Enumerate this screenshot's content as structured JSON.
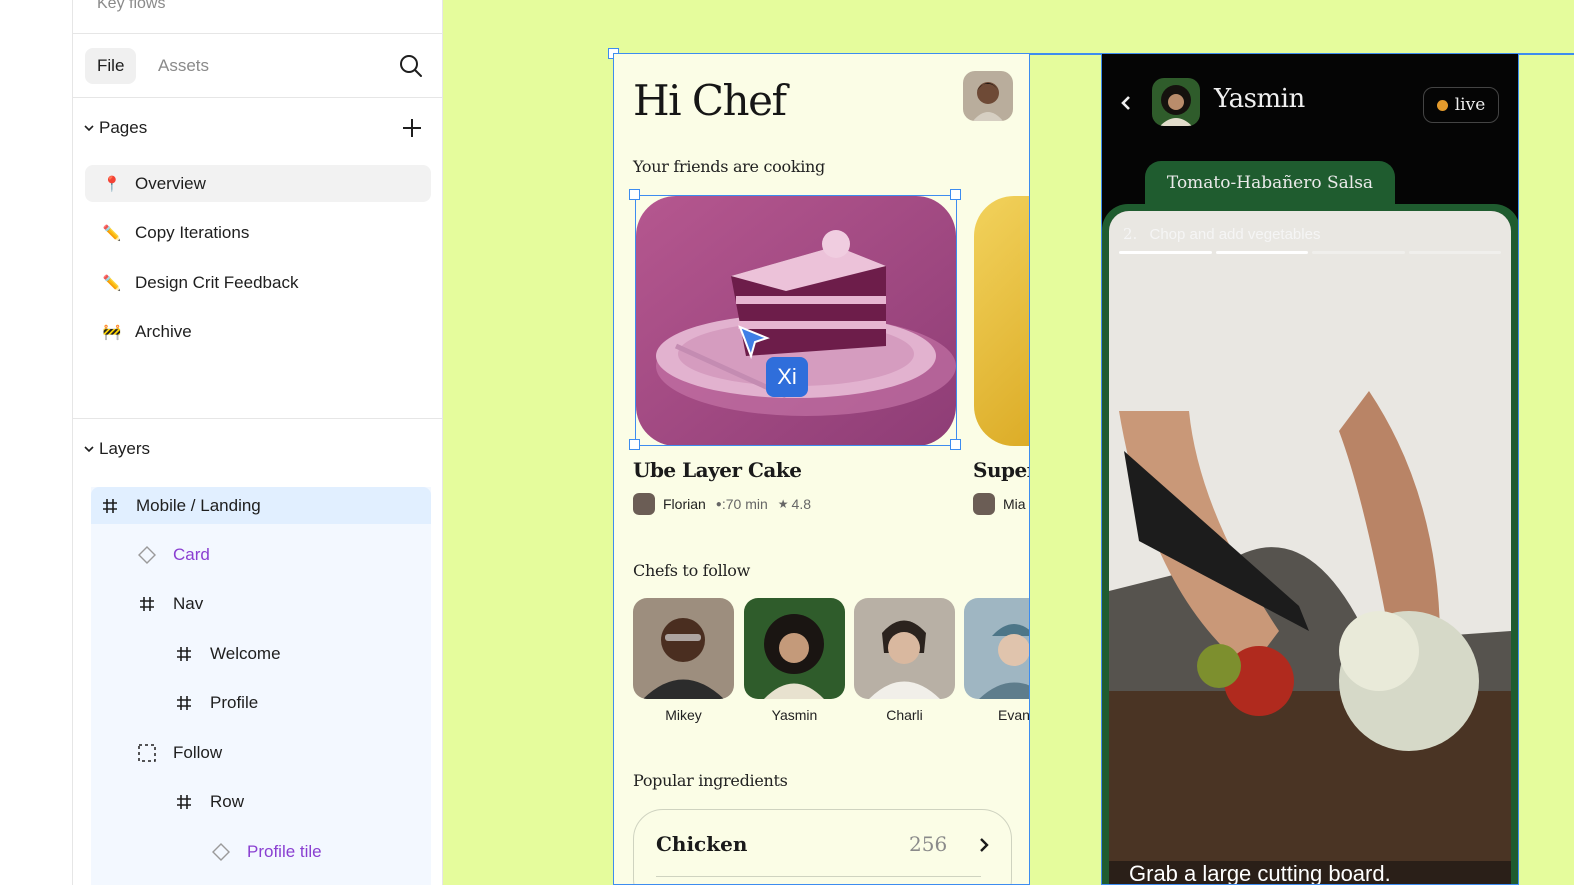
{
  "file": {
    "title": "Key flows"
  },
  "tabs": [
    {
      "label": "File",
      "active": true
    },
    {
      "label": "Assets",
      "active": false
    }
  ],
  "pages": {
    "header": "Pages",
    "items": [
      {
        "icon": "📍",
        "icon_name": "pin-icon",
        "label": "Overview",
        "active": true
      },
      {
        "icon": "✏️",
        "icon_name": "pencil-icon",
        "label": "Copy Iterations",
        "active": false
      },
      {
        "icon": "✏️",
        "icon_name": "pencil-icon",
        "label": "Design Crit Feedback",
        "active": false
      },
      {
        "icon": "🚧",
        "icon_name": "construction-icon",
        "label": "Archive",
        "active": false
      }
    ]
  },
  "layers": {
    "header": "Layers",
    "items": [
      {
        "type": "frame",
        "label": "Mobile / Landing",
        "indent": 0,
        "selected": true
      },
      {
        "type": "component",
        "label": "Card",
        "indent": 1
      },
      {
        "type": "frame",
        "label": "Nav",
        "indent": 1
      },
      {
        "type": "frame",
        "label": "Welcome",
        "indent": 2
      },
      {
        "type": "frame",
        "label": "Profile",
        "indent": 2
      },
      {
        "type": "group",
        "label": "Follow",
        "indent": 1
      },
      {
        "type": "frame",
        "label": "Row",
        "indent": 2
      },
      {
        "type": "component",
        "label": "Profile tile",
        "indent": 3
      }
    ]
  },
  "landing": {
    "greeting": "Hi Chef",
    "friends_title": "Your friends are cooking",
    "recipes": [
      {
        "title": "Ube Layer Cake",
        "author": "Florian",
        "time": ":70 min",
        "rating": "4.8"
      },
      {
        "title": "Super",
        "author": "Mia"
      }
    ],
    "chefs_title": "Chefs to follow",
    "chefs": [
      "Mikey",
      "Yasmin",
      "Charli",
      "Evan"
    ],
    "ingredients_title": "Popular ingredients",
    "ingredients": [
      {
        "name": "Chicken",
        "count": "256"
      }
    ]
  },
  "live": {
    "chef": "Yasmin",
    "badge": "live",
    "recipe": "Tomato-Habañero Salsa",
    "step_number": "2.",
    "step_text": "Chop and add vegetables",
    "steps_total": 4,
    "steps_done": 2,
    "caption": "Grab a large cutting board."
  },
  "collaborator": {
    "initials": "Xi"
  },
  "colors": {
    "canvas": "#e5fc9c",
    "selection": "#3d8cf0",
    "component": "#8a3fd1",
    "live_green": "#1f5c2f",
    "live_dot": "#e39a2c"
  }
}
